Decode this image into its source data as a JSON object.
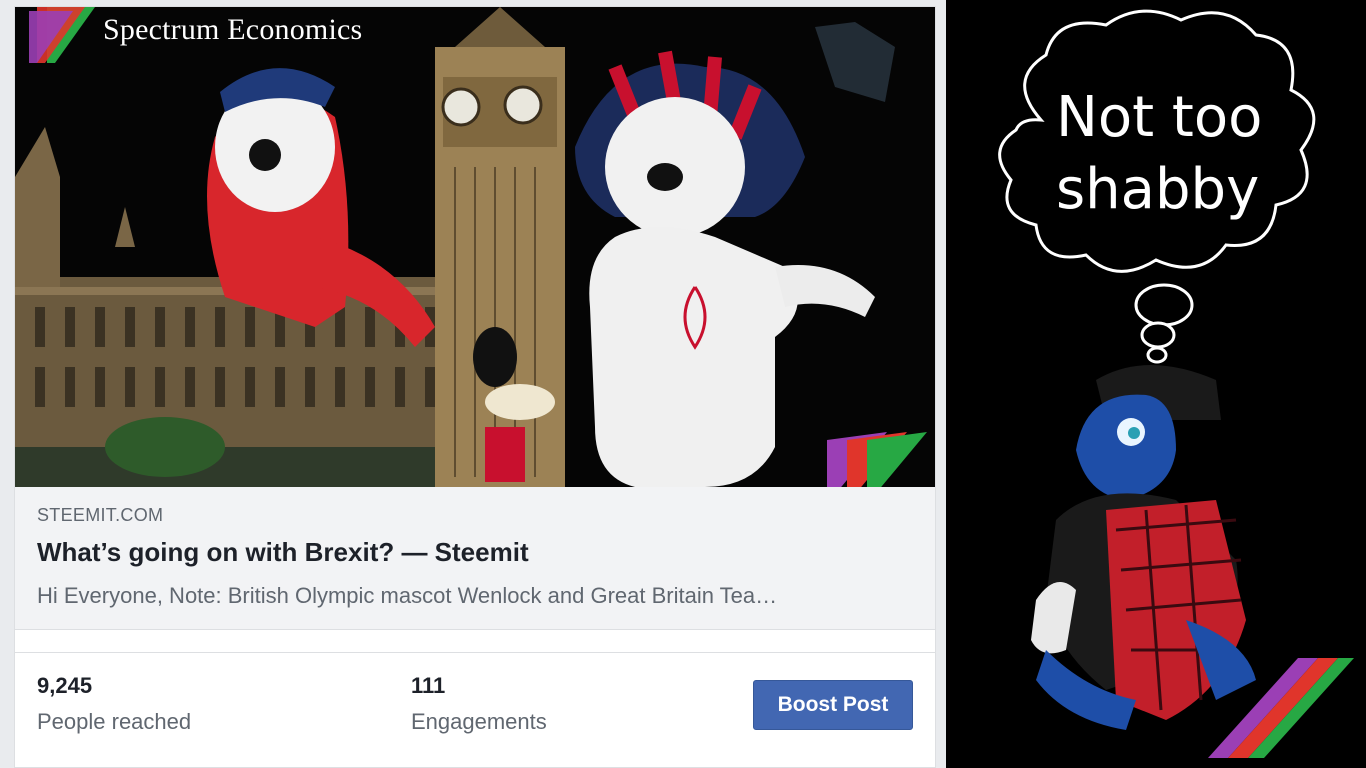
{
  "post": {
    "brand_overlay": "Spectrum Economics",
    "link_domain": "STEEMIT.COM",
    "link_title": "What’s going on with Brexit? — Steemit",
    "link_description": "Hi Everyone, Note: British Olympic mascot Wenlock and Great Britain Tea…"
  },
  "stats": {
    "reach_value": "9,245",
    "reach_label": "People reached",
    "engagement_value": "111",
    "engagement_label": "Engagements"
  },
  "actions": {
    "boost_label": "Boost Post"
  },
  "thought_bubble": {
    "text": "Not too shabby"
  },
  "colors": {
    "boost_button": "#4267b2",
    "logo_purple": "#9b3fb5",
    "logo_red": "#e0352b",
    "logo_green": "#27a844"
  }
}
